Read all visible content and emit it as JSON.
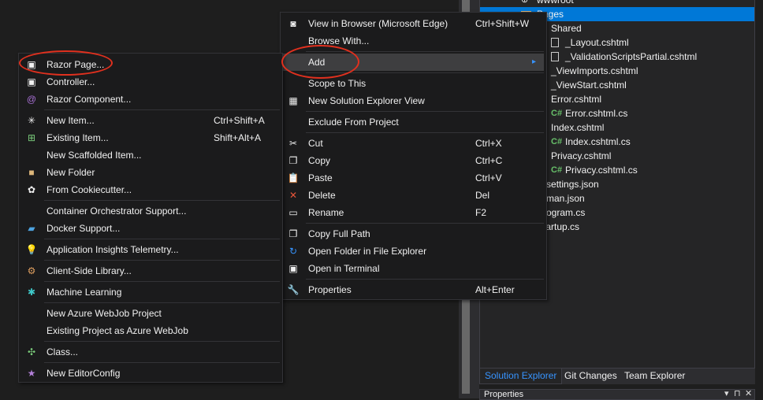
{
  "solution_tree": [
    {
      "label": "wwwroot",
      "icon": "globe-icon"
    },
    {
      "label": "Pages",
      "icon": "folder-icon",
      "selected": true
    },
    {
      "label": "Shared",
      "icon": "folder-icon"
    },
    {
      "label": "_Layout.cshtml",
      "icon": "razor-file-icon"
    },
    {
      "label": "_ValidationScriptsPartial.cshtml",
      "icon": "razor-file-icon"
    },
    {
      "label": "_ViewImports.cshtml",
      "icon": "razor-file-icon"
    },
    {
      "label": "_ViewStart.cshtml",
      "icon": "razor-file-icon"
    },
    {
      "label": "Error.cshtml",
      "icon": "razor-file-icon"
    },
    {
      "label": "Error.cshtml.cs",
      "icon": "csharp-icon"
    },
    {
      "label": "Index.cshtml",
      "icon": "razor-file-icon"
    },
    {
      "label": "Index.cshtml.cs",
      "icon": "csharp-icon"
    },
    {
      "label": "Privacy.cshtml",
      "icon": "razor-file-icon"
    },
    {
      "label": "Privacy.cshtml.cs",
      "icon": "csharp-icon"
    },
    {
      "label": "appsettings.json",
      "icon": "json-icon"
    },
    {
      "label": "libman.json",
      "icon": "json-icon"
    },
    {
      "label": "Program.cs",
      "icon": "csharp-icon"
    },
    {
      "label": "Startup.cs",
      "icon": "csharp-icon"
    }
  ],
  "csharp_glyph": "C#",
  "panel_tabs": [
    "Solution Explorer",
    "Git Changes",
    "Team Explorer"
  ],
  "properties": {
    "title": "Properties",
    "dropdown": "▾",
    "pin": "⊓",
    "close": "✕"
  },
  "context_menu": [
    {
      "label": "View in Browser (Microsoft Edge)",
      "shortcut": "Ctrl+Shift+W",
      "icon": "browser-icon",
      "glyph": "◙"
    },
    {
      "label": "Browse With...",
      "shortcut": "",
      "icon": "",
      "glyph": ""
    },
    {
      "sep": true
    },
    {
      "label": "Add",
      "shortcut": "",
      "icon": "",
      "glyph": "",
      "submenu": true,
      "highlighted": true
    },
    {
      "sep": true
    },
    {
      "label": "Scope to This",
      "shortcut": "",
      "icon": "",
      "glyph": ""
    },
    {
      "label": "New Solution Explorer View",
      "shortcut": "",
      "icon": "solution-explorer-icon",
      "glyph": "▦"
    },
    {
      "sep": true
    },
    {
      "label": "Exclude From Project",
      "shortcut": "",
      "icon": "",
      "glyph": ""
    },
    {
      "sep": true
    },
    {
      "label": "Cut",
      "shortcut": "Ctrl+X",
      "icon": "scissors-icon",
      "glyph": "✂"
    },
    {
      "label": "Copy",
      "shortcut": "Ctrl+C",
      "icon": "copy-icon",
      "glyph": "❐"
    },
    {
      "label": "Paste",
      "shortcut": "Ctrl+V",
      "icon": "paste-icon",
      "glyph": "📋"
    },
    {
      "label": "Delete",
      "shortcut": "Del",
      "icon": "delete-icon",
      "glyph": "✕",
      "color": "#e8563a"
    },
    {
      "label": "Rename",
      "shortcut": "F2",
      "icon": "rename-icon",
      "glyph": "▭"
    },
    {
      "sep": true
    },
    {
      "label": "Copy Full Path",
      "shortcut": "",
      "icon": "copy-icon",
      "glyph": "❐"
    },
    {
      "label": "Open Folder in File Explorer",
      "shortcut": "",
      "icon": "open-folder-icon",
      "glyph": "↻",
      "color": "#3794ff"
    },
    {
      "label": "Open in Terminal",
      "shortcut": "",
      "icon": "terminal-icon",
      "glyph": "▣"
    },
    {
      "sep": true
    },
    {
      "label": "Properties",
      "shortcut": "Alt+Enter",
      "icon": "wrench-icon",
      "glyph": "🔧"
    }
  ],
  "add_submenu": [
    {
      "label": "Razor Page...",
      "shortcut": "",
      "icon": "razor-page-icon",
      "glyph": "▣"
    },
    {
      "label": "Controller...",
      "shortcut": "",
      "icon": "controller-icon",
      "glyph": "▣"
    },
    {
      "label": "Razor Component...",
      "shortcut": "",
      "icon": "razor-component-icon",
      "glyph": "@",
      "color": "#a970d6"
    },
    {
      "sep": true
    },
    {
      "label": "New Item...",
      "shortcut": "Ctrl+Shift+A",
      "icon": "new-item-icon",
      "glyph": "✳"
    },
    {
      "label": "Existing Item...",
      "shortcut": "Shift+Alt+A",
      "icon": "existing-item-icon",
      "glyph": "⊞",
      "color": "#7ccf7c"
    },
    {
      "label": "New Scaffolded Item...",
      "shortcut": "",
      "icon": "",
      "glyph": ""
    },
    {
      "label": "New Folder",
      "shortcut": "",
      "icon": "new-folder-icon",
      "glyph": "■",
      "color": "#dcb67a"
    },
    {
      "label": "From Cookiecutter...",
      "shortcut": "",
      "icon": "cookiecutter-icon",
      "glyph": "✿"
    },
    {
      "sep": true
    },
    {
      "label": "Container Orchestrator Support...",
      "shortcut": "",
      "icon": "",
      "glyph": ""
    },
    {
      "label": "Docker Support...",
      "shortcut": "",
      "icon": "docker-icon",
      "glyph": "▰",
      "color": "#4da3e0"
    },
    {
      "sep": true
    },
    {
      "label": "Application Insights Telemetry...",
      "shortcut": "",
      "icon": "app-insights-icon",
      "glyph": "💡",
      "color": "#b27fd8"
    },
    {
      "sep": true
    },
    {
      "label": "Client-Side Library...",
      "shortcut": "",
      "icon": "client-library-icon",
      "glyph": "⚙",
      "color": "#e0a060"
    },
    {
      "sep": true
    },
    {
      "label": "Machine Learning",
      "shortcut": "",
      "icon": "machine-learning-icon",
      "glyph": "✱",
      "color": "#3fc8c8"
    },
    {
      "sep": true
    },
    {
      "label": "New Azure WebJob Project",
      "shortcut": "",
      "icon": "",
      "glyph": ""
    },
    {
      "label": "Existing Project as Azure WebJob",
      "shortcut": "",
      "icon": "",
      "glyph": ""
    },
    {
      "sep": true
    },
    {
      "label": "Class...",
      "shortcut": "",
      "icon": "class-icon",
      "glyph": "✣",
      "color": "#7ccf7c"
    },
    {
      "sep": true
    },
    {
      "label": "New EditorConfig",
      "shortcut": "",
      "icon": "editorconfig-icon",
      "glyph": "★",
      "color": "#b27fd8"
    }
  ],
  "submenu_arrow": "▸",
  "colors": {
    "selection": "#0078d7",
    "highlight_ring": "#e0301e",
    "active_tab": "#3794ff"
  }
}
